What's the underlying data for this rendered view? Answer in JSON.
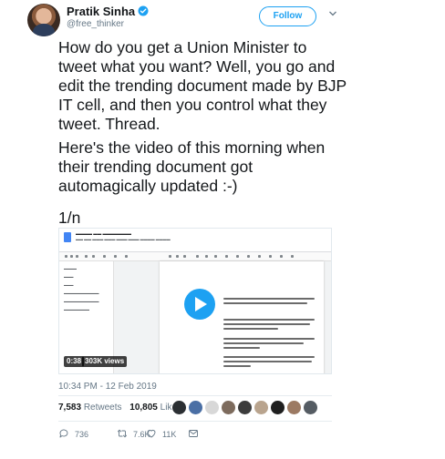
{
  "user": {
    "name": "Pratik Sinha",
    "handle": "@free_thinker",
    "verified": true
  },
  "follow_label": "Follow",
  "tweet": {
    "paragraphs": [
      "How do you get a Union Minister to\ntweet what you want? Well, you go and\nedit the trending document made by BJP\nIT cell, and then you control what they\ntweet. Thread.",
      "Here's the video of this morning when\ntheir trending document got\nautomagically updated :-)",
      "1/n"
    ]
  },
  "video": {
    "duration": "0:38",
    "views": "303K views"
  },
  "timestamp": "10:34 PM - 12 Feb 2019",
  "stats": {
    "retweets_count": "7,583",
    "retweets_label": "Retweets",
    "likes_count": "10,805",
    "likes_label": "Likes"
  },
  "actions": {
    "reply_count": "736",
    "retweet_count": "7.6K",
    "like_count": "11K"
  },
  "colors": {
    "accent": "#1da1f2",
    "text": "#14171a",
    "muted": "#657786"
  },
  "icons": [
    "verified-icon",
    "caret-down-icon",
    "play-icon",
    "reply-icon",
    "retweet-icon",
    "like-icon",
    "message-icon"
  ]
}
